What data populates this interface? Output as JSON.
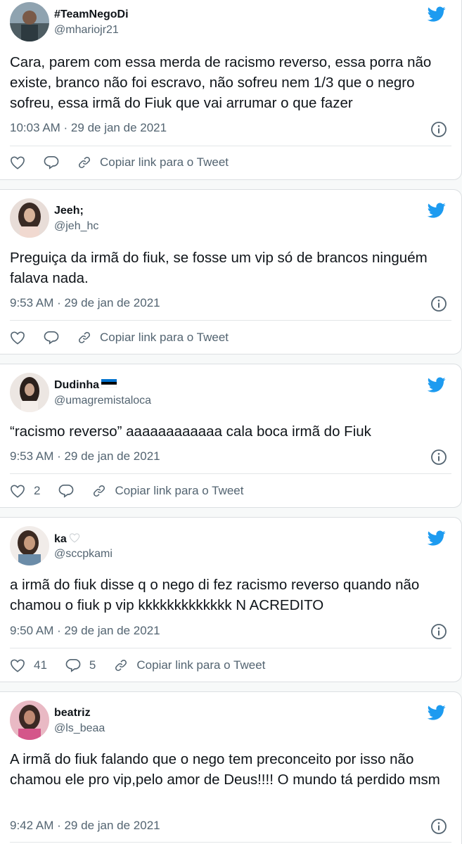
{
  "tweets": [
    {
      "name": "#TeamNegoDi",
      "handle": "@mhariojr21",
      "text": "Cara, parem com essa merda de racismo reverso, essa porra não existe, branco não foi escravo, não sofreu nem 1/3 que o negro sofreu, essa irmã do Fiuk que vai arrumar o que fazer",
      "time": "10:03 AM · 29 de jan de 2021",
      "likes": "",
      "replies": "",
      "copy_label": "Copiar link para o Tweet"
    },
    {
      "name": "Jeeh;",
      "handle": "@jeh_hc",
      "text": "Preguiça da irmã do fiuk,  se fosse um vip só de brancos ninguém falava nada.",
      "time": "9:53 AM · 29 de jan de 2021",
      "likes": "",
      "replies": "",
      "copy_label": "Copiar link para o Tweet"
    },
    {
      "name": "Dudinha",
      "handle": "@umagremistaloca",
      "text": "“racismo reverso” aaaaaaaaaaaa cala boca irmã do Fiuk",
      "time": "9:53 AM · 29 de jan de 2021",
      "likes": "2",
      "replies": "",
      "copy_label": "Copiar link para o Tweet"
    },
    {
      "name": "ka",
      "handle": "@sccpkami",
      "text": "a irmã do fiuk disse q o nego di fez racismo reverso quando não chamou o fiuk p vip kkkkkkkkkkkkk N ACREDITO",
      "time": "9:50 AM · 29 de jan de 2021",
      "likes": "41",
      "replies": "5",
      "copy_label": "Copiar link para o Tweet"
    },
    {
      "name": "beatriz",
      "handle": "@ls_beaa",
      "text": "A irmã do fiuk falando que o nego tem preconceito por isso não chamou ele pro vip,pelo amor de Deus!!!! O mundo tá perdido msm",
      "time": "9:42 AM · 29 de jan de 2021",
      "likes": "",
      "replies": "",
      "copy_label": ""
    }
  ],
  "colors": {
    "twitter_blue": "#1d9bf0",
    "text": "#0f1419",
    "secondary": "#536471",
    "border": "#dcdfe2"
  },
  "icons": [
    "twitter-bird-icon",
    "info-icon",
    "heart-icon",
    "reply-icon",
    "link-icon",
    "estonia-flag-icon",
    "white-heart-icon"
  ]
}
